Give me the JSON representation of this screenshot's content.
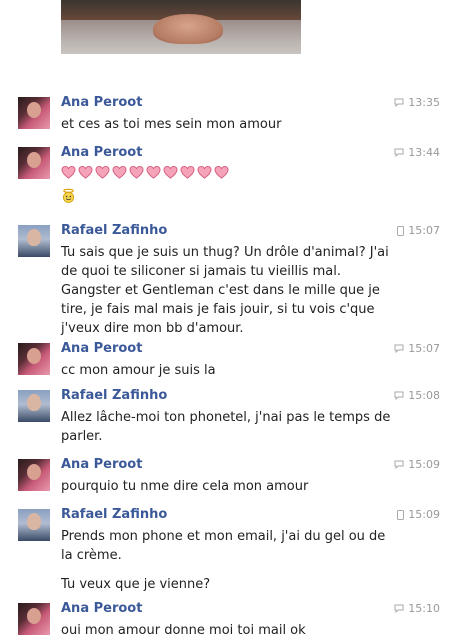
{
  "messages": [
    {
      "sender": "Ana Peroot",
      "time": "13:35",
      "lines": [
        "et ces as toi mes sein mon amour"
      ],
      "channel": "chat"
    },
    {
      "sender": "Ana Peroot",
      "time": "13:44",
      "heart_count": 10,
      "emojis": [
        "heart",
        "angel"
      ],
      "channel": "chat"
    },
    {
      "sender": "Rafael Zafinho",
      "time": "15:07",
      "channel": "mobile",
      "lines": [
        "Tu sais que je suis un thug? Un drôle d'animal? J'ai",
        "de quoi te siliconer si jamais tu vieillis mal.",
        "Gangster et Gentleman c'est dans le mille que je",
        "tire, je fais mal mais je fais jouir, si tu vois c'que",
        "j'veux dire mon bb d'amour."
      ]
    },
    {
      "sender": "Ana Peroot",
      "time": "15:07",
      "lines": [
        "cc mon amour je suis la"
      ],
      "channel": "chat"
    },
    {
      "sender": "Rafael Zafinho",
      "time": "15:08",
      "channel": "chat",
      "lines": [
        "Allez lâche-moi ton phonetel, j'nai pas le temps de",
        "parler."
      ]
    },
    {
      "sender": "Ana Peroot",
      "time": "15:09",
      "lines": [
        "pourquio tu nme dire cela mon amour"
      ],
      "channel": "chat"
    },
    {
      "sender": "Rafael Zafinho",
      "time": "15:09",
      "channel": "mobile",
      "lines": [
        "Prends mon phone et mon email, j'ai du gel ou de",
        "la crème."
      ],
      "extra_line": "Tu veux que je vienne?"
    },
    {
      "sender": "Ana Peroot",
      "time": "15:10",
      "lines": [
        "oui mon amour donne moi toi mail ok"
      ],
      "channel": "chat"
    }
  ]
}
